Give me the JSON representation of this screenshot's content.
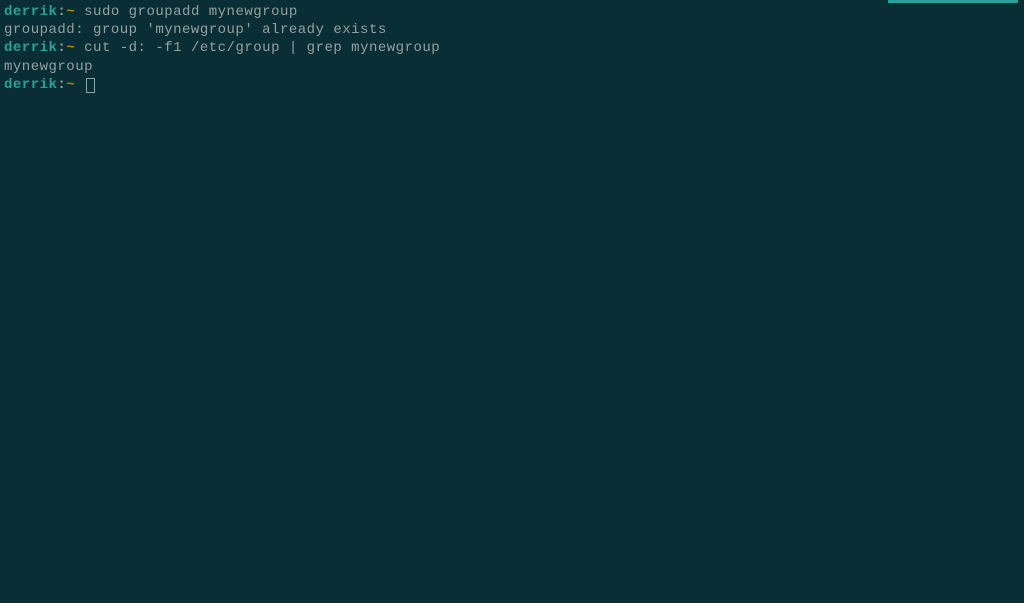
{
  "terminal": {
    "lines": [
      {
        "type": "prompt",
        "user": "derrik",
        "sep": ":",
        "path": "~",
        "command": " sudo groupadd mynewgroup"
      },
      {
        "type": "output",
        "text": "groupadd: group 'mynewgroup' already exists"
      },
      {
        "type": "prompt",
        "user": "derrik",
        "sep": ":",
        "path": "~",
        "command": " cut -d: -f1 /etc/group | grep mynewgroup"
      },
      {
        "type": "output",
        "text": "mynewgroup"
      },
      {
        "type": "prompt-cursor",
        "user": "derrik",
        "sep": ":",
        "path": "~",
        "command": " "
      }
    ]
  }
}
